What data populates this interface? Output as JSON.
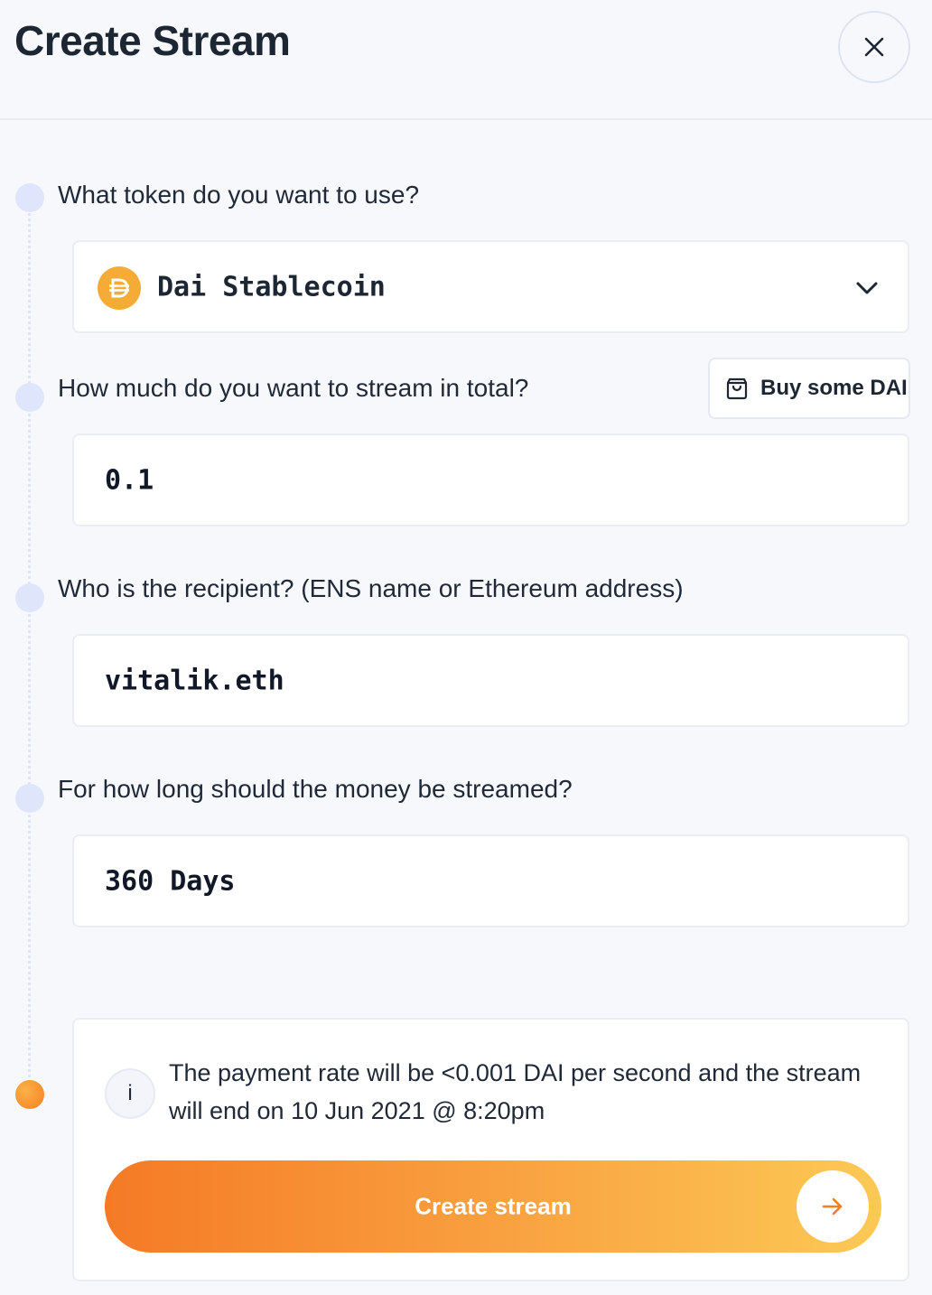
{
  "header": {
    "title": "Create Stream",
    "close_icon": "close-icon"
  },
  "token": {
    "question": "What token do you want to use?",
    "selected": "Dai Stablecoin",
    "icon": "dai-icon",
    "icon_color": "#f5ac37"
  },
  "amount": {
    "question": "How much do you want to stream in total?",
    "value": "0.1",
    "buy_label": "Buy some DAI",
    "buy_icon": "shopping-bag-icon"
  },
  "recipient": {
    "question": "Who is the recipient? (ENS name or Ethereum address)",
    "value": "vitalik.eth"
  },
  "duration": {
    "question": "For how long should the money be streamed?",
    "value": "360 Days"
  },
  "summary": {
    "info_glyph": "i",
    "text": "The payment rate will be <0.001 DAI per second and the stream will end on 10 Jun 2021 @ 8:20pm",
    "button_label": "Create stream",
    "accent_start": "#f57a26",
    "accent_end": "#fcc955"
  }
}
